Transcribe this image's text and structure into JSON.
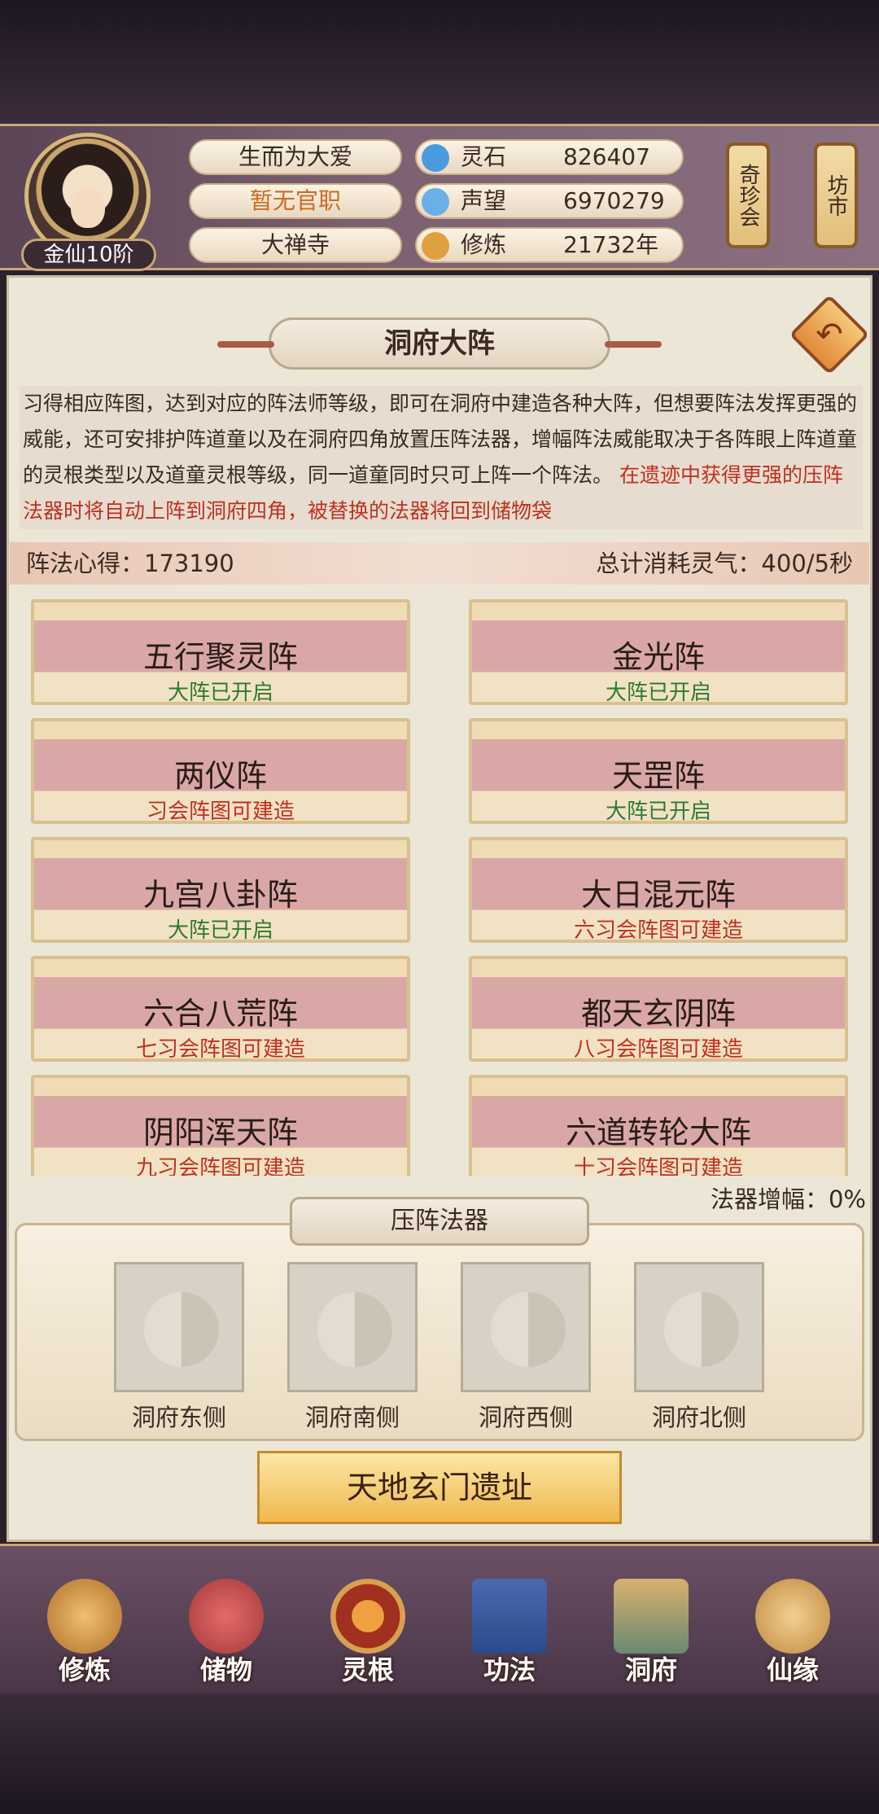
{
  "header": {
    "rank": "金仙10阶",
    "motto": "生而为大爱",
    "official": "暂无官职",
    "sect": "大禅寺",
    "resources": [
      {
        "label": "灵石",
        "value": "826407",
        "icon": "spirit-stone-icon"
      },
      {
        "label": "声望",
        "value": "6970279",
        "icon": "reputation-icon"
      },
      {
        "label": "修炼",
        "value": "21732年",
        "icon": "meditation-icon"
      }
    ],
    "shop1": "奇珍会",
    "shop2": "坊市"
  },
  "page": {
    "title": "洞府大阵",
    "desc": "习得相应阵图，达到对应的阵法师等级，即可在洞府中建造各种大阵，但想要阵法发挥更强的威能，还可安排护阵道童以及在洞府四角放置压阵法器，增幅阵法威能取决于各阵眼上阵道童的灵根类型以及道童灵根等级，同一道童同时只可上阵一个阵法。",
    "warning": "在遗迹中获得更强的压阵法器时将自动上阵到洞府四角，被替换的法器将回到储物袋",
    "insight": "阵法心得：173190",
    "consume": "总计消耗灵气：400/5秒"
  },
  "formations": [
    {
      "name": "五行聚灵阵",
      "status": "大阵已开启",
      "color": "#2f7a2f"
    },
    {
      "name": "金光阵",
      "status": "大阵已开启",
      "color": "#2f7a2f"
    },
    {
      "name": "两仪阵",
      "status": "习会阵图可建造",
      "color": "#c03020"
    },
    {
      "name": "天罡阵",
      "status": "大阵已开启",
      "color": "#2f7a2f"
    },
    {
      "name": "九宫八卦阵",
      "status": "大阵已开启",
      "color": "#2f7a2f"
    },
    {
      "name": "大日混元阵",
      "status": "六习会阵图可建造",
      "color": "#c03020"
    },
    {
      "name": "六合八荒阵",
      "status": "七习会阵图可建造",
      "color": "#c03020"
    },
    {
      "name": "都天玄阴阵",
      "status": "八习会阵图可建造",
      "color": "#c03020"
    },
    {
      "name": "阴阳浑天阵",
      "status": "九习会阵图可建造",
      "color": "#c03020"
    },
    {
      "name": "六道转轮大阵",
      "status": "十习会阵图可建造",
      "color": "#c03020"
    }
  ],
  "artifact": {
    "amp": "法器增幅：0%",
    "title": "压阵法器",
    "slots": [
      "洞府东侧",
      "洞府南侧",
      "洞府西侧",
      "洞府北侧"
    ],
    "button": "天地玄门遗址"
  },
  "nav": [
    "修炼",
    "储物",
    "灵根",
    "功法",
    "洞府",
    "仙缘"
  ]
}
